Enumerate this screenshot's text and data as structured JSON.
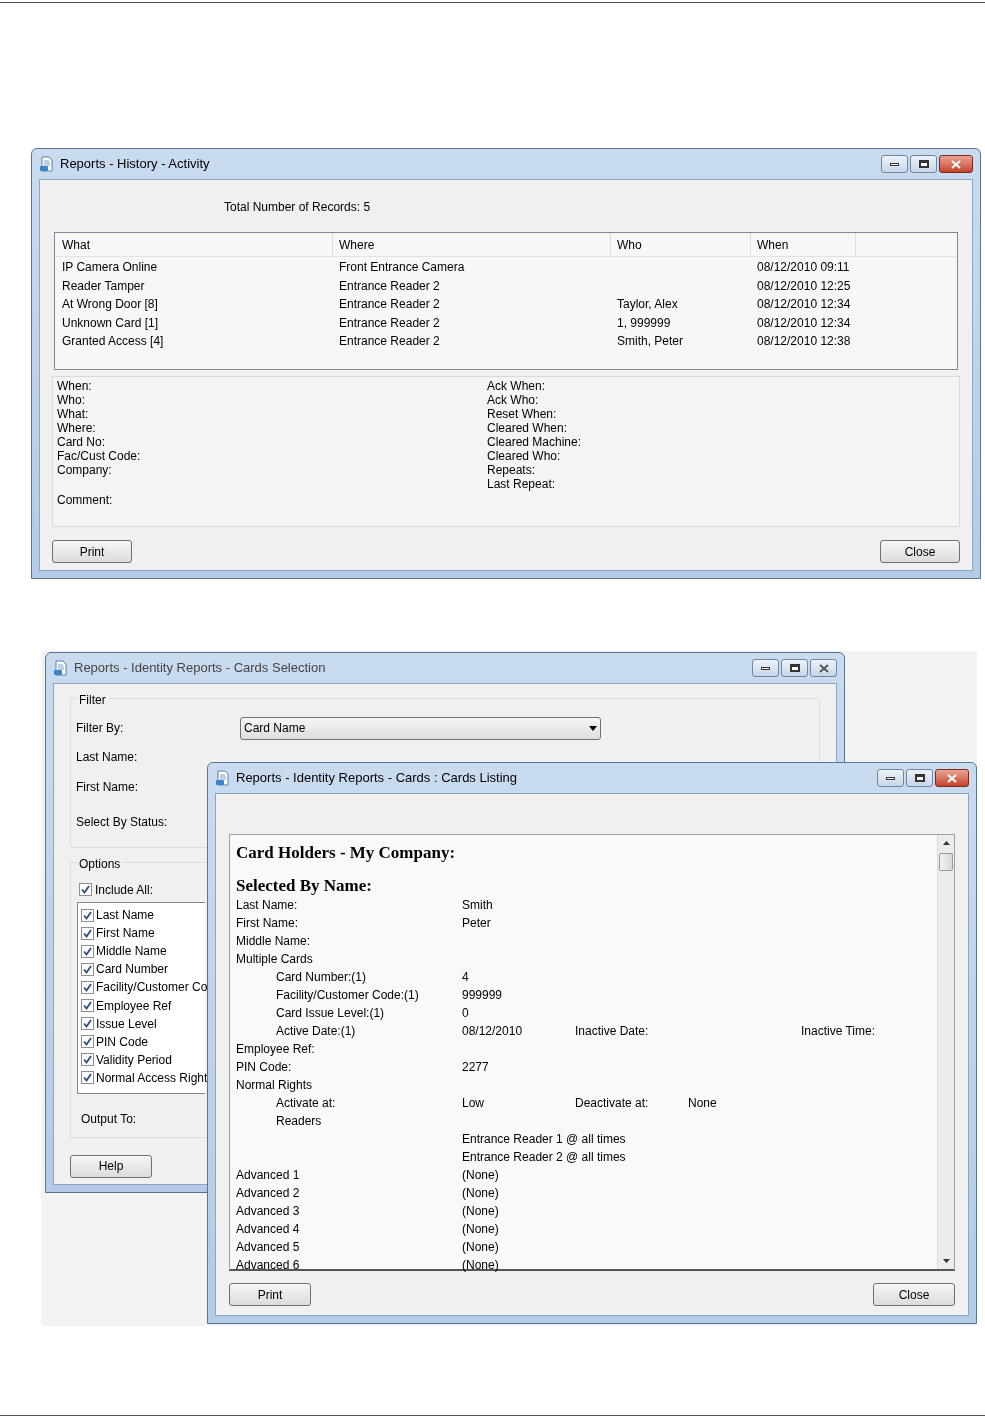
{
  "activity_window": {
    "title": "Reports - History - Activity",
    "active": true,
    "total_records": "Total Number of Records: 5",
    "table": {
      "columns": [
        "What",
        "Where",
        "Who",
        "When"
      ],
      "rows": [
        [
          "IP Camera Online",
          "Front Entrance Camera",
          "",
          "08/12/2010 09:11"
        ],
        [
          "Reader Tamper",
          "Entrance Reader 2",
          "",
          "08/12/2010 12:25"
        ],
        [
          "At Wrong Door [8]",
          "Entrance Reader 2",
          "Taylor, Alex",
          "08/12/2010 12:34"
        ],
        [
          "Unknown Card [1]",
          "Entrance Reader 2",
          "1, 999999",
          "08/12/2010 12:34"
        ],
        [
          "Granted Access [4]",
          "Entrance Reader 2",
          "Smith, Peter",
          "08/12/2010 12:38"
        ]
      ]
    },
    "details_left": [
      "When:",
      "Who:",
      "What:",
      "Where:",
      "Card No:",
      "Fac/Cust Code:",
      "Company:"
    ],
    "details_comment": "Comment:",
    "details_right": [
      "Ack When:",
      "Ack Who:",
      "Reset When:",
      "Cleared When:",
      "Cleared Machine:",
      "Cleared Who:",
      "Repeats:",
      "Last Repeat:"
    ],
    "print_button": "Print",
    "close_button": "Close"
  },
  "selection_window": {
    "title": "Reports - Identity Reports - Cards Selection",
    "active": false,
    "filter_group": "Filter",
    "filter_by_label": "Filter By:",
    "filter_by_value": "Card Name",
    "last_name_label": "Last Name:",
    "first_name_label": "First Name:",
    "status_label": "Select By Status:",
    "options_group": "Options",
    "include_all": {
      "label": "Include All:",
      "checked": true
    },
    "fields": [
      {
        "label": "Last Name",
        "checked": true
      },
      {
        "label": "First Name",
        "checked": true
      },
      {
        "label": "Middle Name",
        "checked": true
      },
      {
        "label": "Card Number",
        "checked": true
      },
      {
        "label": "Facility/Customer Co",
        "checked": true
      },
      {
        "label": "Employee Ref",
        "checked": true
      },
      {
        "label": "Issue Level",
        "checked": true
      },
      {
        "label": "PIN Code",
        "checked": true
      },
      {
        "label": "Validity Period",
        "checked": true
      },
      {
        "label": "Normal Access Right",
        "checked": true
      }
    ],
    "output_label": "Output To:",
    "help_button": "Help"
  },
  "listing_window": {
    "title": "Reports - Identity Reports - Cards : Cards Listing",
    "active": true,
    "heading": "Card Holders - My Company:",
    "subheading": "Selected By Name:",
    "lines": [
      {
        "label": "Last Name:",
        "value": "Smith"
      },
      {
        "label": "First Name:",
        "value": "Peter"
      },
      {
        "label": "Middle Name:"
      },
      {
        "label": "Multiple Cards",
        "children": [
          {
            "label": "Card Number:(1)",
            "value": "4"
          },
          {
            "label": "Facility/Customer Code:(1)",
            "value": "999999"
          },
          {
            "label": "Card Issue Level:(1)",
            "value": "0"
          },
          {
            "label": "Active Date:(1)",
            "value": "08/12/2010",
            "label_2": "Inactive Date:",
            "label_3": "Inactive Time:"
          }
        ]
      },
      {
        "label": "Employee Ref:"
      },
      {
        "label": "PIN Code:",
        "value": "2277"
      },
      {
        "label": "Normal Rights",
        "children": [
          {
            "label": "Activate at:",
            "value": "Low",
            "label_2": "Deactivate at:",
            "value_2": "None"
          },
          {
            "label": "Readers"
          },
          {
            "value": "Entrance Reader 1 @ all times"
          },
          {
            "value": "Entrance Reader 2 @ all times"
          }
        ]
      },
      {
        "label": "Advanced 1",
        "value": "(None)"
      },
      {
        "label": "Advanced 2",
        "value": "(None)"
      },
      {
        "label": "Advanced 3",
        "value": "(None)"
      },
      {
        "label": "Advanced 4",
        "value": "(None)"
      },
      {
        "label": "Advanced 5",
        "value": "(None)"
      },
      {
        "label": "Advanced 6",
        "value": "(None)"
      }
    ],
    "print_button": "Print",
    "close_button": "Close"
  }
}
